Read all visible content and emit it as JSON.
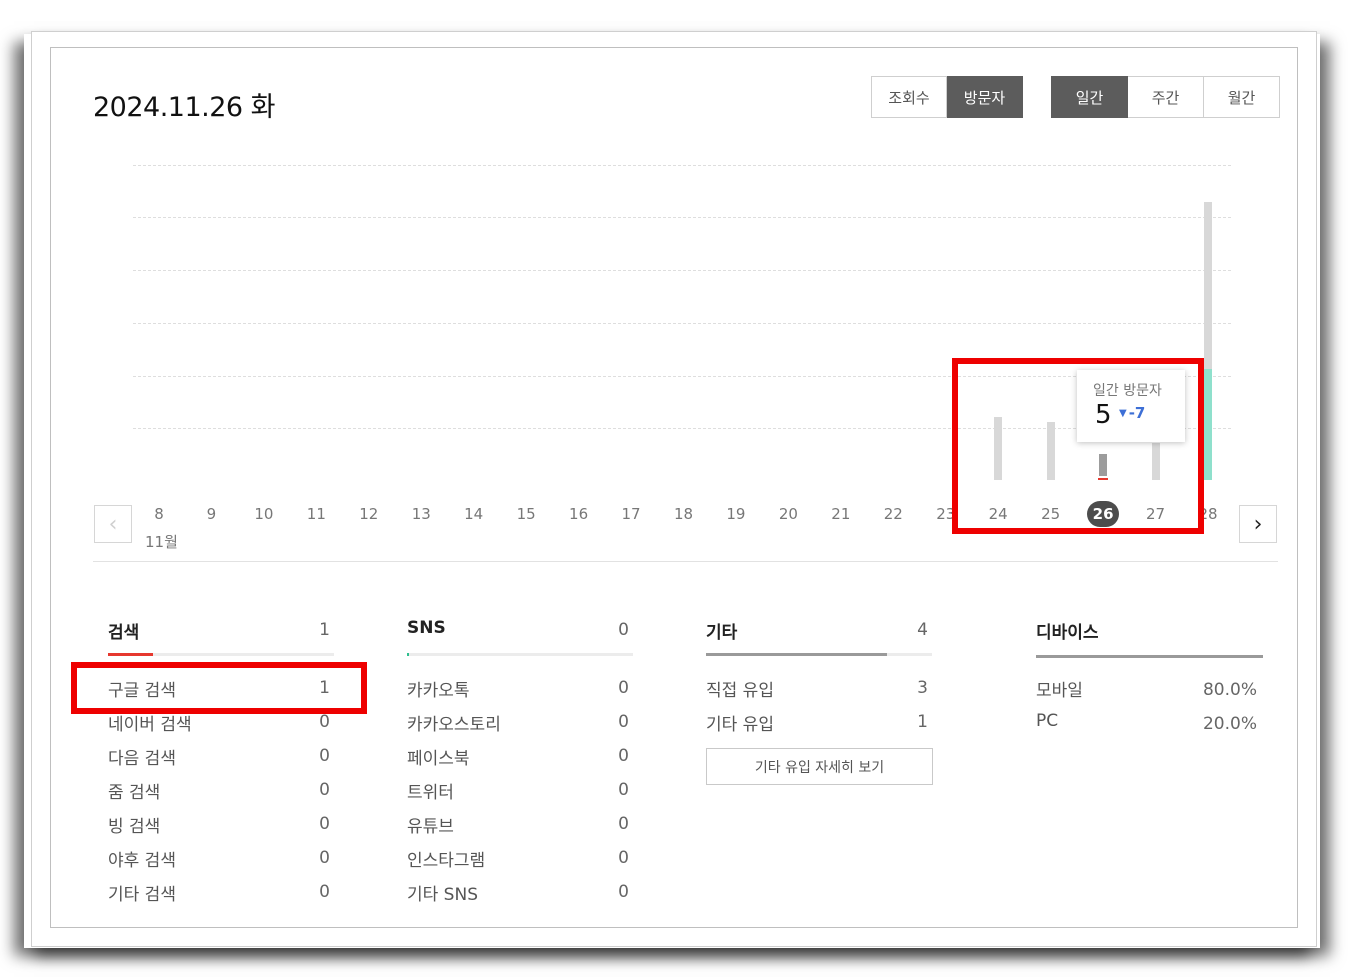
{
  "header": {
    "date": "2024.11.26 화"
  },
  "metric_tabs": [
    {
      "label": "조회수",
      "active": false
    },
    {
      "label": "방문자",
      "active": true
    }
  ],
  "period_tabs": [
    {
      "label": "일간",
      "active": true
    },
    {
      "label": "주간",
      "active": false
    },
    {
      "label": "월간",
      "active": false
    }
  ],
  "chart_data": {
    "type": "bar",
    "month_label": "11월",
    "categories": [
      "8",
      "9",
      "10",
      "11",
      "12",
      "13",
      "14",
      "15",
      "16",
      "17",
      "18",
      "19",
      "20",
      "21",
      "22",
      "23",
      "24",
      "25",
      "26",
      "27",
      "28"
    ],
    "selected_category": "26",
    "visible_bars": [
      {
        "x": "24",
        "value": 12,
        "style": "gray"
      },
      {
        "x": "25",
        "value": 11,
        "style": "gray"
      },
      {
        "x": "26",
        "value": 5,
        "style": "selected"
      },
      {
        "x": "27",
        "value": 7,
        "style": "gray"
      },
      {
        "x": "28",
        "value": 53,
        "style": "split"
      }
    ],
    "grid": true,
    "tooltip": {
      "title": "일간 방문자",
      "value": "5",
      "change": "-7",
      "change_color": "#3d6fd6"
    }
  },
  "nav": {
    "prev_icon": "chevron-left-icon",
    "next_icon": "chevron-right-icon"
  },
  "stats": {
    "search": {
      "title": "검색",
      "total": "1",
      "fill_fraction": 0.2,
      "fill_color": "#e6382e",
      "rows": [
        {
          "label": "구글 검색",
          "value": "1"
        },
        {
          "label": "네이버 검색",
          "value": "0"
        },
        {
          "label": "다음 검색",
          "value": "0"
        },
        {
          "label": "줌 검색",
          "value": "0"
        },
        {
          "label": "빙 검색",
          "value": "0"
        },
        {
          "label": "야후 검색",
          "value": "0"
        },
        {
          "label": "기타 검색",
          "value": "0"
        }
      ]
    },
    "sns": {
      "title": "SNS",
      "total": "0",
      "fill_fraction": 0.01,
      "fill_color": "#2fbf8f",
      "rows": [
        {
          "label": "카카오톡",
          "value": "0"
        },
        {
          "label": "카카오스토리",
          "value": "0"
        },
        {
          "label": "페이스북",
          "value": "0"
        },
        {
          "label": "트위터",
          "value": "0"
        },
        {
          "label": "유튜브",
          "value": "0"
        },
        {
          "label": "인스타그램",
          "value": "0"
        },
        {
          "label": "기타 SNS",
          "value": "0"
        }
      ]
    },
    "other": {
      "title": "기타",
      "total": "4",
      "fill_fraction": 0.8,
      "fill_color": "#9a9a9a",
      "rows": [
        {
          "label": "직접 유입",
          "value": "3"
        },
        {
          "label": "기타 유입",
          "value": "1"
        }
      ],
      "detail_button": "기타 유입 자세히 보기"
    },
    "device": {
      "title": "디바이스",
      "fill_fraction": 1.0,
      "fill_color": "#9a9a9a",
      "rows": [
        {
          "label": "모바일",
          "value": "80.0%"
        },
        {
          "label": "PC",
          "value": "20.0%"
        }
      ]
    }
  },
  "colors": {
    "highlight": "#ee0000",
    "bar_gray": "#d8d8d8",
    "bar_mint": "#8fe0cc",
    "active_tab": "#5c5c5c"
  }
}
